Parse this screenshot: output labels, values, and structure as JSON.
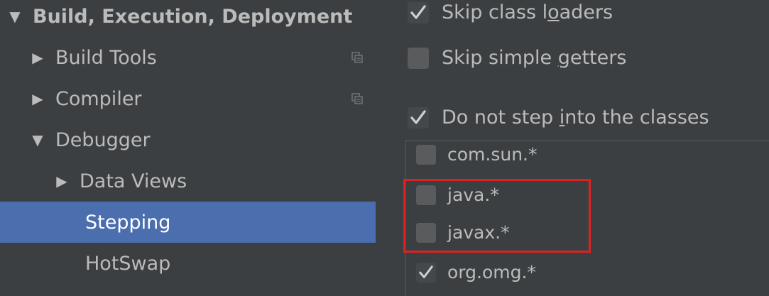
{
  "tree": {
    "items": [
      {
        "label": "Build, Execution, Deployment",
        "arrow": "▼",
        "bold": true
      },
      {
        "label": "Build Tools",
        "arrow": "▶",
        "project_icon": true
      },
      {
        "label": "Compiler",
        "arrow": "▶",
        "project_icon": true
      },
      {
        "label": "Debugger",
        "arrow": "▼"
      },
      {
        "label": "Data Views",
        "arrow": "▶"
      },
      {
        "label": "Stepping",
        "selected": true
      },
      {
        "label": "HotSwap"
      }
    ]
  },
  "settings": {
    "skip_class_loaders": {
      "pre": "Skip class l",
      "mn": "o",
      "post": "aders",
      "checked": true
    },
    "skip_simple_getters": {
      "pre": "Skip simple ",
      "mn": "g",
      "post": "etters",
      "checked": false
    },
    "do_not_step_into": {
      "pre": "Do not step ",
      "mn": "i",
      "post": "nto the classes",
      "checked": true
    },
    "class_list": [
      {
        "label": "com.sun.*",
        "checked": false
      },
      {
        "label": "java.*",
        "checked": false
      },
      {
        "label": "javax.*",
        "checked": false
      },
      {
        "label": "org.omg.*",
        "checked": true
      }
    ]
  },
  "colors": {
    "background": "#3c3f41",
    "selection": "#4b6eaf",
    "highlight": "#e02020",
    "text": "#bbbbbb"
  }
}
